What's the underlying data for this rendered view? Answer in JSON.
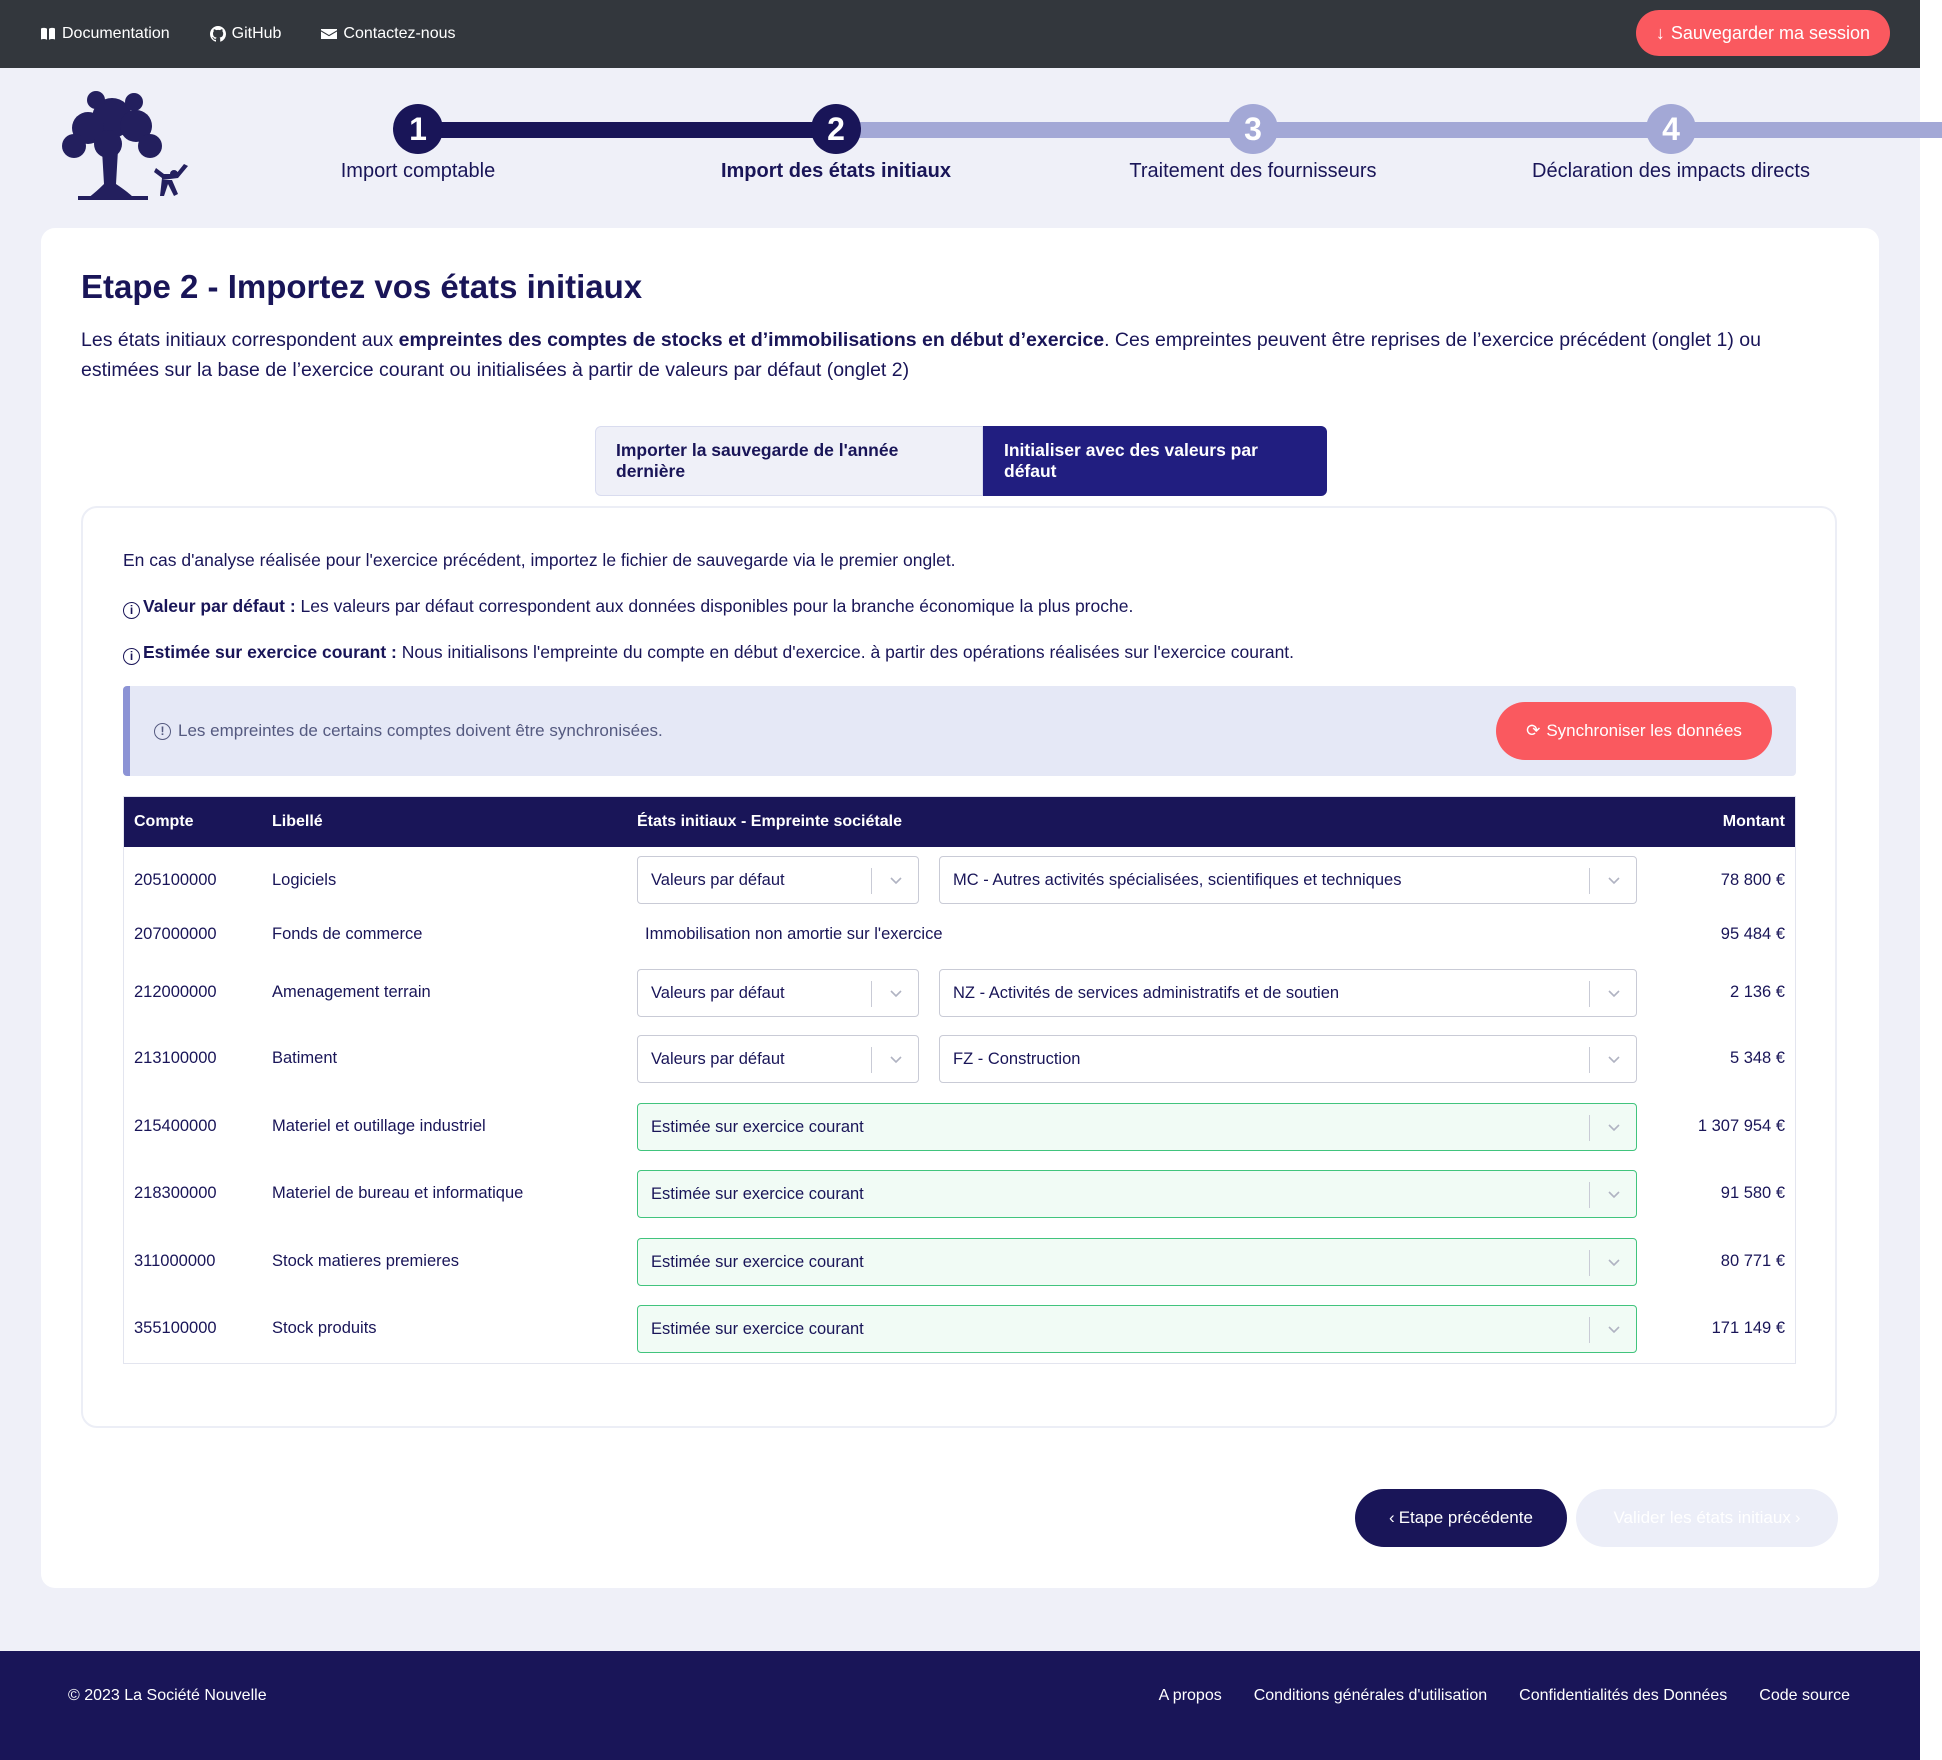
{
  "topbar": {
    "links": [
      {
        "label": "Documentation",
        "icon": "book-icon"
      },
      {
        "label": "GitHub",
        "icon": "github-icon"
      },
      {
        "label": "Contactez-nous",
        "icon": "envelope-icon"
      }
    ],
    "save_label": "Sauvegarder ma session"
  },
  "stepper": {
    "steps": [
      {
        "number": "1",
        "label": "Import comptable"
      },
      {
        "number": "2",
        "label": "Import des états initiaux"
      },
      {
        "number": "3",
        "label": "Traitement des fournisseurs"
      },
      {
        "number": "4",
        "label": "Déclaration des impacts directs"
      }
    ],
    "current": 2
  },
  "main": {
    "title": "Etape 2 - Importez vos états initiaux",
    "intro_part1": "Les états initiaux correspondent aux ",
    "intro_bold": "empreintes des comptes de stocks et d’immobilisations en début d’exercice",
    "intro_part2": ". Ces empreintes peuvent être reprises de l’exercice précédent (onglet 1) ou estimées sur la base de l’exercice courant ou initialisées à partir de valeurs par défaut (onglet 2)",
    "tabs": [
      {
        "label": "Importer la sauvegarde de l'année dernière"
      },
      {
        "label": "Initialiser avec des valeurs par défaut"
      }
    ],
    "panel": {
      "line1": "En cas d'analyse réalisée pour l'exercice précédent, importez le fichier de sauvegarde via le premier onglet.",
      "line2_bold": "Valeur par défaut :",
      "line2": " Les valeurs par défaut correspondent aux données disponibles pour la branche économique la plus proche.",
      "line3_bold": "Estimée sur exercice courant :",
      "line3": " Nous initialisons l'empreinte du compte en début d'exercice. à partir des opérations réalisées sur l'exercice courant.",
      "alert_text": "Les empreintes de certains comptes doivent être synchronisées.",
      "sync_label": "Synchroniser les données"
    },
    "table": {
      "headers": {
        "account": "Compte",
        "label": "Libellé",
        "footprint": "États initiaux - Empreinte sociétale",
        "amount": "Montant"
      },
      "rows": [
        {
          "account": "205100000",
          "label": "Logiciels",
          "method": "Valeurs par défaut",
          "branch": "MC - Autres activités spécialisées, scientifiques et techniques",
          "amount": "78 800 €"
        },
        {
          "account": "207000000",
          "label": "Fonds de commerce",
          "note": "Immobilisation non amortie sur l'exercice",
          "amount": "95 484 €"
        },
        {
          "account": "212000000",
          "label": "Amenagement terrain",
          "method": "Valeurs par défaut",
          "branch": "NZ - Activités de services administratifs et de soutien",
          "amount": "2 136 €"
        },
        {
          "account": "213100000",
          "label": "Batiment",
          "method": "Valeurs par défaut",
          "branch": "FZ - Construction",
          "amount": "5 348 €"
        },
        {
          "account": "215400000",
          "label": "Materiel et outillage industriel",
          "estimate": "Estimée sur exercice courant",
          "amount": "1 307 954 €"
        },
        {
          "account": "218300000",
          "label": "Materiel de bureau et informatique",
          "estimate": "Estimée sur exercice courant",
          "amount": "91 580 €"
        },
        {
          "account": "311000000",
          "label": "Stock matieres premieres",
          "estimate": "Estimée sur exercice courant",
          "amount": "80 771 €"
        },
        {
          "account": "355100000",
          "label": "Stock produits",
          "estimate": "Estimée sur exercice courant",
          "amount": "171 149 €"
        }
      ]
    },
    "prev_label": "Etape précédente",
    "next_label": "Valider les états initiaux"
  },
  "footer": {
    "copyright": "© 2023 La Société Nouvelle",
    "links": [
      "A propos",
      "Conditions générales d'utilisation",
      "Confidentialités des Données",
      "Code source"
    ]
  },
  "colors": {
    "primary": "#191558",
    "accent": "#fa595f",
    "estimate_border": "#41c47d",
    "todo_step": "#a3a8d6"
  }
}
